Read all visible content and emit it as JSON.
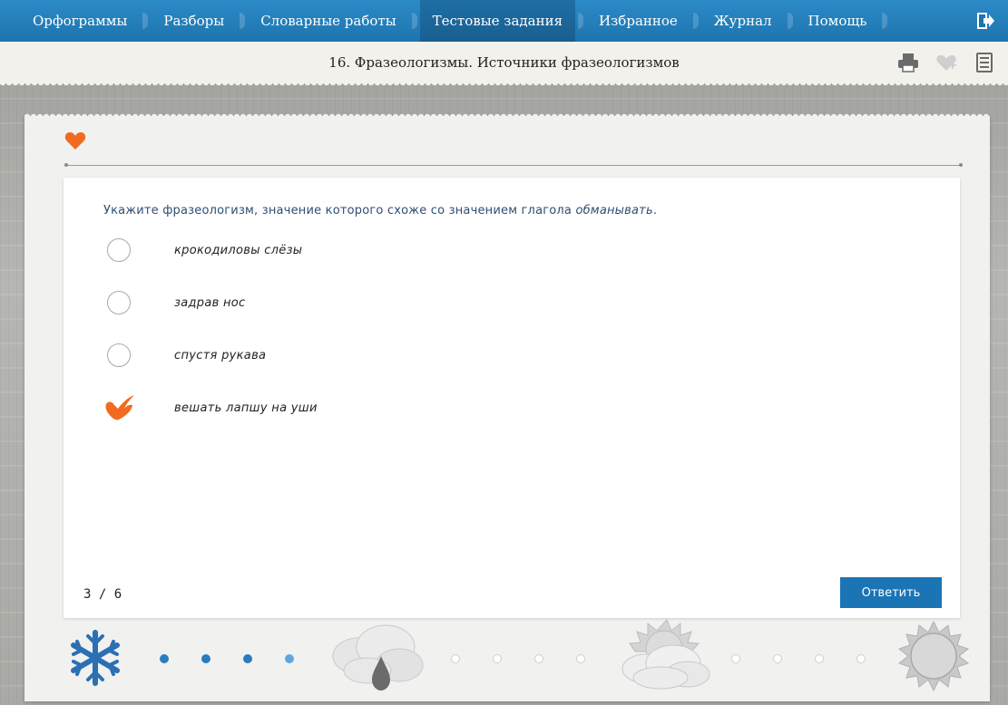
{
  "nav": {
    "items": [
      {
        "label": "Орфограммы",
        "active": false
      },
      {
        "label": "Разборы",
        "active": false
      },
      {
        "label": "Словарные работы",
        "active": false
      },
      {
        "label": "Тестовые задания",
        "active": true
      },
      {
        "label": "Избранное",
        "active": false
      },
      {
        "label": "Журнал",
        "active": false
      },
      {
        "label": "Помощь",
        "active": false
      }
    ],
    "exit_icon": "exit-icon"
  },
  "header": {
    "title": "16. Фразеологизмы. Источники фразеологизмов",
    "tools": [
      "printer-icon",
      "heart-add-icon",
      "list-icon"
    ]
  },
  "task": {
    "question_prefix": "Укажите фразеологизм, значение которого схоже со значением глагола ",
    "question_emphasis": "обманывать",
    "question_suffix": ".",
    "options": [
      {
        "label": "крокодиловы слёзы",
        "selected": false
      },
      {
        "label": "задрав нос",
        "selected": false
      },
      {
        "label": "спустя рукава",
        "selected": false
      },
      {
        "label": "вешать лапшу на уши",
        "selected": true
      }
    ],
    "counter": "3 / 6",
    "answer_label": "Ответить"
  },
  "progress": {
    "completed": 4,
    "total": 12,
    "stage_icons": [
      "snowflake-icon",
      "cloud-rain-icon",
      "sun-cloud-icon",
      "sun-icon"
    ]
  },
  "colors": {
    "nav_bg": "#1d74ad",
    "accent_orange": "#f26a21",
    "button_blue": "#1b74b4",
    "question_text": "#2e4e72",
    "dot_done": "#2b7bbf"
  }
}
